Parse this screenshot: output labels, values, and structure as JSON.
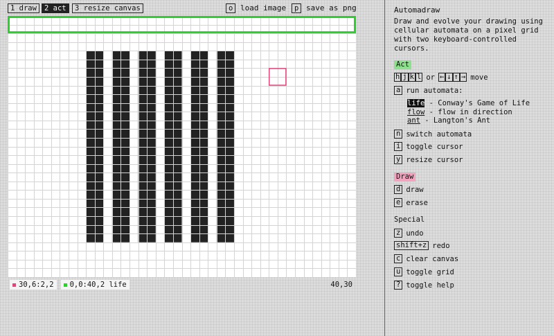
{
  "toolbar": {
    "draw": "1 draw",
    "act": "2 act",
    "resize": "3 resize canvas",
    "load_key": "o",
    "load_label": "load image",
    "save_key": "p",
    "save_label": "save as png"
  },
  "status": {
    "pink_cursor": "30,6:2,2",
    "green_cursor": "0,0:40,2 life",
    "canvas_size": "40,30"
  },
  "colors": {
    "act_cursor": "#2bd02b",
    "draw_cursor": "#e0457b",
    "act_tag_bg": "#8ee08e",
    "draw_tag_bg": "#f2a3bd",
    "pixel": "#222222"
  },
  "help": {
    "title": "Automadraw",
    "description": "Draw and evolve your drawing using cellular automata on a pixel grid with two keyboard-controlled cursors.",
    "act_section": "Act",
    "move_keys": [
      "h",
      "j",
      "k",
      "l"
    ],
    "move_or": "or",
    "move_arrows": [
      "←",
      "↓",
      "↑",
      "→"
    ],
    "move_label": "move",
    "run_key": "a",
    "run_label": "run automata:",
    "automata": [
      {
        "name": "life",
        "desc": " - Conway's Game of Life"
      },
      {
        "name": "flow",
        "desc": " - flow in direction"
      },
      {
        "name": "ant",
        "desc": " - Langton's Ant"
      }
    ],
    "switch_key": "n",
    "switch_label": "switch automata",
    "toggle_cursor_key": "i",
    "toggle_cursor_label": "toggle cursor",
    "resize_cursor_key": "y",
    "resize_cursor_label": "resize cursor",
    "draw_section": "Draw",
    "draw_key": "d",
    "draw_label": "draw",
    "erase_key": "e",
    "erase_label": "erase",
    "special_section": "Special",
    "undo_key": "z",
    "undo_label": "undo",
    "redo_key": "shift+z",
    "redo_label": "redo",
    "clear_key": "c",
    "clear_label": "clear canvas",
    "grid_key": "u",
    "grid_label": "toggle grid",
    "help_key": "?",
    "help_label": "toggle help"
  }
}
